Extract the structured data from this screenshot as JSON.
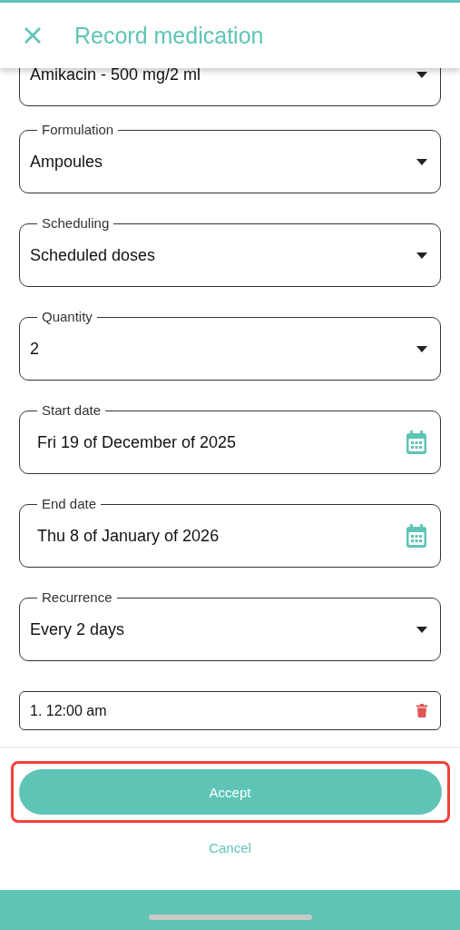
{
  "header": {
    "title": "Record medication"
  },
  "fields": [
    {
      "kind": "select",
      "value": "Amikacin - 500 mg/2 ml"
    },
    {
      "kind": "select",
      "label": "Formulation",
      "value": "Ampoules"
    },
    {
      "kind": "select",
      "label": "Scheduling",
      "value": "Scheduled doses"
    },
    {
      "kind": "select",
      "label": "Quantity",
      "value": "2"
    },
    {
      "kind": "date",
      "label": "Start date",
      "value": "Fri 19 of December of 2025"
    },
    {
      "kind": "date",
      "label": "End date",
      "value": "Thu 8 of January of 2026"
    },
    {
      "kind": "select",
      "label": "Recurrence",
      "value": "Every 2 days"
    }
  ],
  "times": [
    {
      "value": "1. 12:00 am"
    }
  ],
  "accept": {
    "label": "Accept",
    "highlighted": true
  },
  "cancel": {
    "label": "Cancel"
  }
}
